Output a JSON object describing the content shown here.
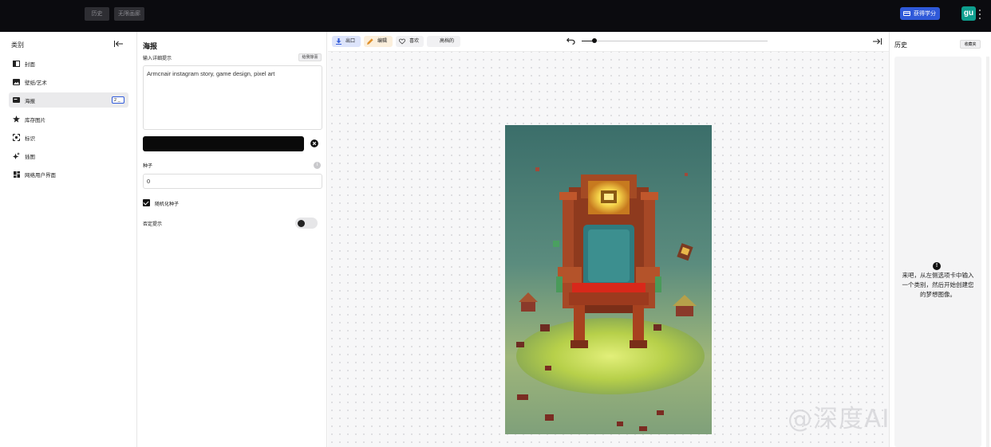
{
  "topbar": {
    "history_label": "历史",
    "unlock_label": "无限画廊",
    "credits_label": "获得学分",
    "avatar_text": "gu"
  },
  "categories": {
    "title": "类别",
    "items": [
      {
        "label": "封面",
        "icon": "cover-icon"
      },
      {
        "label": "壁纸/艺术",
        "icon": "image-icon"
      },
      {
        "label": "海报",
        "icon": "poster-icon",
        "badge": "2 _",
        "active": true
      },
      {
        "label": "库存图片",
        "icon": "star-icon"
      },
      {
        "label": "标识",
        "icon": "logo-icon"
      },
      {
        "label": "插图",
        "icon": "sparkle-icon"
      },
      {
        "label": "网络用户界面",
        "icon": "grid-icon"
      }
    ]
  },
  "editor": {
    "title": "海报",
    "detail_label": "输入详细提示",
    "surprise_label": "给我惊喜",
    "prompt_value": "Armcnair instagram story, game design, pixel art",
    "seed_label": "种子",
    "seed_value": "0",
    "randomize_label": "随机化种子",
    "randomize_checked": true,
    "negative_label": "否定提示",
    "negative_enabled": false
  },
  "toolbar": {
    "export_label": "出口",
    "edit_label": "编辑",
    "like_label": "喜欢",
    "hd_label": "高档的",
    "zoom_fraction": 0.07
  },
  "canvas": {
    "watermark": "@深度AI|赋能"
  },
  "history": {
    "title": "历史",
    "favorites_label": "收藏夹",
    "empty_message": "来吧，从左侧选项卡中输入一个类别，然后开始创建您的梦想图像。"
  },
  "colors": {
    "accent_blue": "#2f59d9",
    "avatar_teal": "#0e9e8e",
    "topbar_bg": "#0b0b0f"
  }
}
